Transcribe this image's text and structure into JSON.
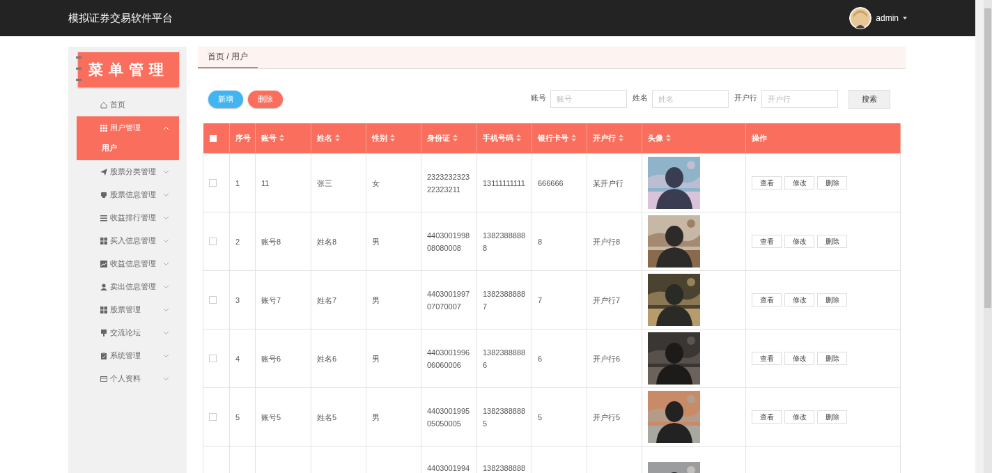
{
  "topbar": {
    "title": "模拟证券交易软件平台",
    "user": {
      "name": "admin"
    }
  },
  "sidebar": {
    "logo_text": "菜单管理",
    "items": [
      {
        "label": "首页",
        "expanded": false
      },
      {
        "label": "用户管理",
        "expanded": true,
        "children": [
          {
            "label": "用户",
            "selected": true
          }
        ]
      },
      {
        "label": "股票分类管理",
        "expanded": false
      },
      {
        "label": "股票信息管理",
        "expanded": false
      },
      {
        "label": "收益排行管理",
        "expanded": false
      },
      {
        "label": "买入信息管理",
        "expanded": false
      },
      {
        "label": "收益信息管理",
        "expanded": false
      },
      {
        "label": "卖出信息管理",
        "expanded": false
      },
      {
        "label": "股票管理",
        "expanded": false
      },
      {
        "label": "交流论坛",
        "expanded": false
      },
      {
        "label": "系统管理",
        "expanded": false
      },
      {
        "label": "个人资料",
        "expanded": false
      }
    ]
  },
  "breadcrumb": "首页 / 用户",
  "toolbar": {
    "buttons": [
      {
        "label": "新增",
        "kind": "add"
      },
      {
        "label": "删除",
        "kind": "delete"
      }
    ],
    "filters": [
      {
        "label": "账号",
        "placeholder": "账号"
      },
      {
        "label": "姓名",
        "placeholder": "姓名"
      },
      {
        "label": "开户行",
        "placeholder": "开户行"
      }
    ],
    "search_button": "搜索"
  },
  "table": {
    "header_checked": false,
    "columns": [
      {
        "label": "序号",
        "sortable": false
      },
      {
        "label": "账号",
        "sortable": true
      },
      {
        "label": "姓名",
        "sortable": true
      },
      {
        "label": "性别",
        "sortable": true
      },
      {
        "label": "身份证",
        "sortable": true
      },
      {
        "label": "手机号码",
        "sortable": true
      },
      {
        "label": "银行卡号",
        "sortable": true
      },
      {
        "label": "开户行",
        "sortable": true
      },
      {
        "label": "头像",
        "sortable": true
      },
      {
        "label": "操作",
        "sortable": false
      }
    ],
    "rows": [
      {
        "checked": false,
        "no": "1",
        "account": "11",
        "name": "张三",
        "gender": "女",
        "id_card": "232323232322323211",
        "phone": "13111111111",
        "bank_card": "666666",
        "bank": "某开户行",
        "actions": [
          "查看",
          "修改",
          "删除"
        ]
      },
      {
        "checked": false,
        "no": "2",
        "account": "账号8",
        "name": "姓名8",
        "gender": "男",
        "id_card": "440300199808080008",
        "phone": "13823888888",
        "bank_card": "8",
        "bank": "开户行8",
        "actions": [
          "查看",
          "修改",
          "删除"
        ]
      },
      {
        "checked": false,
        "no": "3",
        "account": "账号7",
        "name": "姓名7",
        "gender": "男",
        "id_card": "440300199707070007",
        "phone": "13823888887",
        "bank_card": "7",
        "bank": "开户行7",
        "actions": [
          "查看",
          "修改",
          "删除"
        ]
      },
      {
        "checked": false,
        "no": "4",
        "account": "账号6",
        "name": "姓名6",
        "gender": "男",
        "id_card": "440300199606060006",
        "phone": "13823888886",
        "bank_card": "6",
        "bank": "开户行6",
        "actions": [
          "查看",
          "修改",
          "删除"
        ]
      },
      {
        "checked": false,
        "no": "5",
        "account": "账号5",
        "name": "姓名5",
        "gender": "男",
        "id_card": "440300199505050005",
        "phone": "13823888885",
        "bank_card": "5",
        "bank": "开户行5",
        "actions": [
          "查看",
          "修改",
          "删除"
        ]
      },
      {
        "id_card": "4403001994",
        "phone": "1382388888"
      }
    ]
  }
}
